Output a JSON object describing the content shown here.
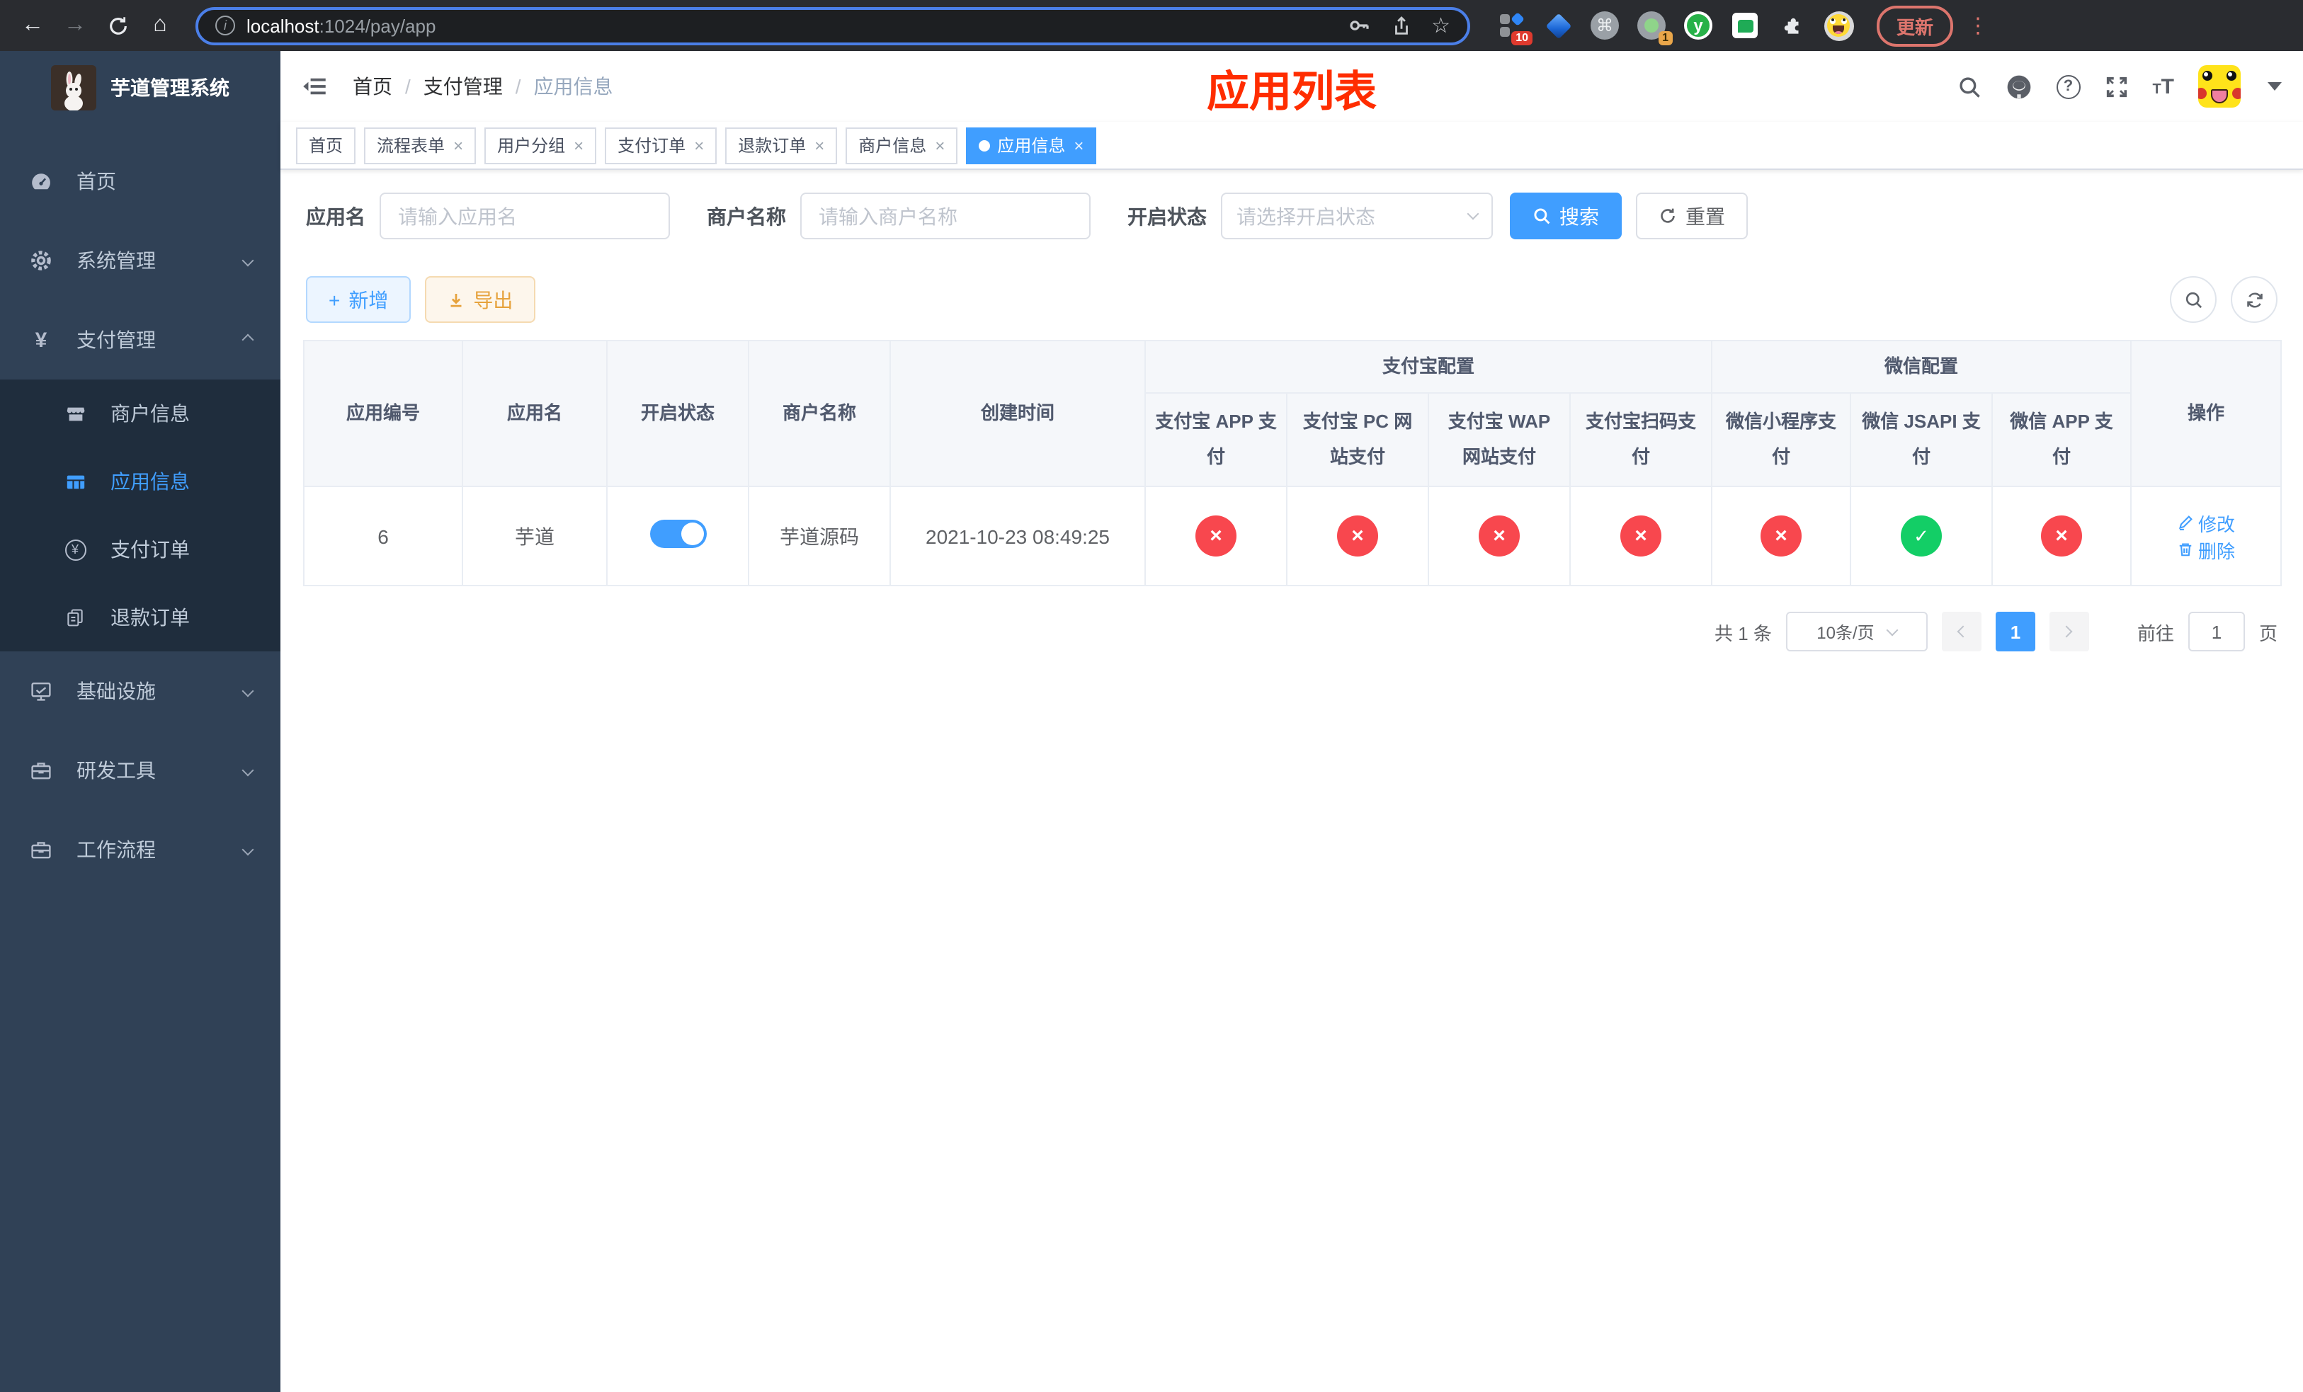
{
  "browser": {
    "url": {
      "host": "localhost",
      "rest": ":1024/pay/app"
    },
    "update_button": "更新",
    "ext_badges": {
      "grid": "10",
      "circle": "1"
    },
    "ext_y_label": "y"
  },
  "icons": {
    "back": "←",
    "forward": "→",
    "home": "⌂",
    "star": "☆",
    "info": "i",
    "command": "⌘",
    "kebab": "⋮",
    "question": "?",
    "caret_close": "×",
    "tsize_small": "T",
    "tsize_big": "T",
    "yen": "¥",
    "plus": "+",
    "download": "↓",
    "refresh_small": "↻"
  },
  "sidebar": {
    "title": "芋道管理系统",
    "items": [
      {
        "label": "首页"
      },
      {
        "label": "系统管理"
      },
      {
        "label": "支付管理"
      },
      {
        "label": "基础设施"
      },
      {
        "label": "研发工具"
      },
      {
        "label": "工作流程"
      }
    ],
    "payment_submenu": [
      {
        "label": "商户信息"
      },
      {
        "label": "应用信息"
      },
      {
        "label": "支付订单"
      },
      {
        "label": "退款订单"
      }
    ]
  },
  "header": {
    "breadcrumb": [
      "首页",
      "支付管理",
      "应用信息"
    ],
    "page_label": "应用列表"
  },
  "tabs": [
    {
      "label": "首页"
    },
    {
      "label": "流程表单"
    },
    {
      "label": "用户分组"
    },
    {
      "label": "支付订单"
    },
    {
      "label": "退款订单"
    },
    {
      "label": "商户信息"
    },
    {
      "label": "应用信息"
    }
  ],
  "filters": {
    "app_name_label": "应用名",
    "app_name_placeholder": "请输入应用名",
    "merchant_label": "商户名称",
    "merchant_placeholder": "请输入商户名称",
    "status_label": "开启状态",
    "status_placeholder": "请选择开启状态",
    "search_button": "搜索",
    "reset_button": "重置"
  },
  "toolbar": {
    "add_button": "新增",
    "export_button": "导出"
  },
  "table": {
    "columns": {
      "app_id": "应用编号",
      "app_name": "应用名",
      "open_status": "开启状态",
      "merchant_name": "商户名称",
      "create_time": "创建时间",
      "alipay_group": "支付宝配置",
      "wechat_group": "微信配置",
      "alipay_app": "支付宝 APP 支付",
      "alipay_pc": "支付宝 PC 网站支付",
      "alipay_wap": "支付宝 WAP 网站支付",
      "alipay_scan": "支付宝扫码支付",
      "wechat_lite": "微信小程序支付",
      "wechat_jsapi": "微信 JSAPI 支付",
      "wechat_app": "微信 APP 支付",
      "actions": "操作"
    },
    "row": {
      "app_id": "6",
      "app_name": "芋道",
      "merchant_name": "芋道源码",
      "create_time": "2021-10-23 08:49:25",
      "statuses": [
        "cross",
        "cross",
        "cross",
        "cross",
        "cross",
        "check",
        "cross"
      ],
      "edit_label": "修改",
      "delete_label": "删除"
    }
  },
  "pagination": {
    "total": "共 1 条",
    "page_size": "10条/页",
    "current_page": "1",
    "goto_label": "前往",
    "goto_value": "1",
    "page_unit": "页"
  },
  "colors": {
    "accent": "#409eff",
    "danger": "#f8474e",
    "success": "#13ce66",
    "warning": "#e6a23c",
    "title_red": "#ff2d00",
    "sidebar_bg": "#304156",
    "submenu_bg": "#1f2d3d"
  }
}
